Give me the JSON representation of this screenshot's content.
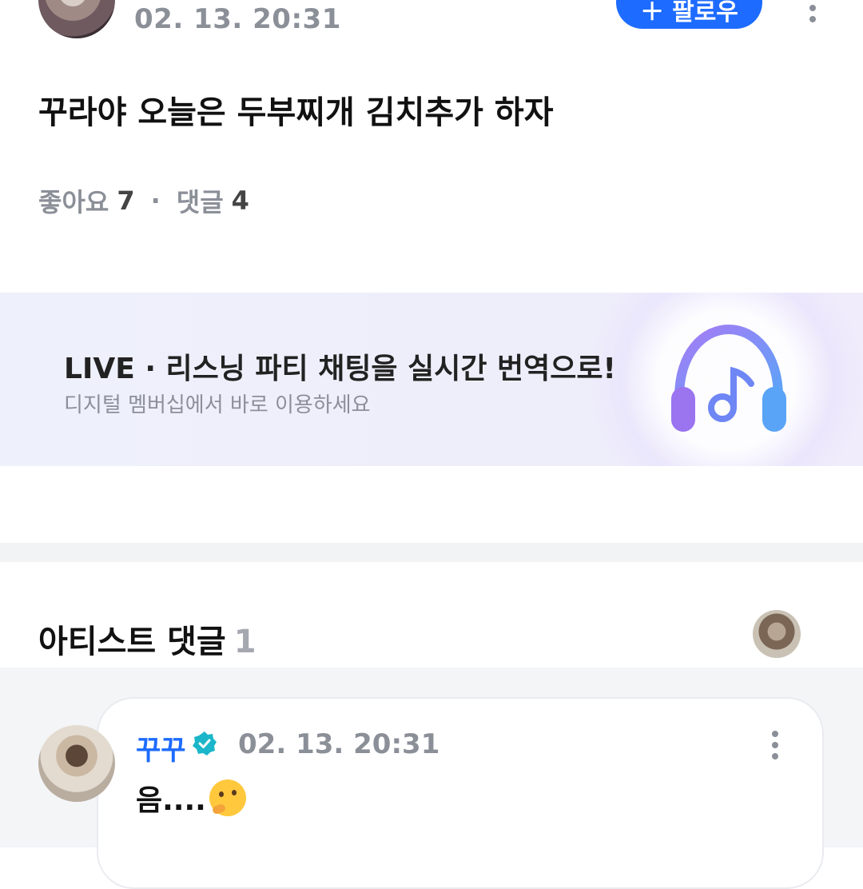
{
  "post": {
    "time": "02. 13. 20:31",
    "follow_label": "팔로우",
    "follow_icon": "plus-icon",
    "body": "꾸라야 오늘은 두부찌개 김치추가 하자",
    "likes_label": "좋아요",
    "likes_count": "7",
    "separator": "·",
    "comments_label": "댓글",
    "comments_count": "4"
  },
  "banner": {
    "title": "LIVE · 리스닝 파티 채팅을 실시간 번역으로!",
    "subtitle": "디지털 멤버십에서 바로 이용하세요",
    "icon": "headphones-music-icon"
  },
  "artist_comments": {
    "title": "아티스트 댓글",
    "count": "1"
  },
  "comment": {
    "author": "꾸꾸",
    "verified_icon": "verified-badge-icon",
    "time": "02. 13. 20:31",
    "text": "음....",
    "emoji": "thinking-face-emoji"
  },
  "colors": {
    "accent": "#1d6bff",
    "muted": "#8b8f98",
    "verified": "#1bb6c9"
  }
}
